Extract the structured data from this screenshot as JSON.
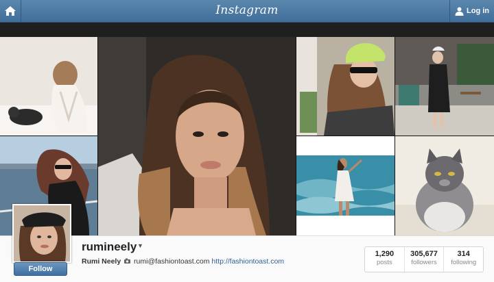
{
  "app": {
    "title": "Instagram",
    "login_label": "Log in"
  },
  "icons": {
    "home": "home-icon",
    "user": "user-icon",
    "camera": "camera-icon"
  },
  "profile": {
    "username": "rumineely",
    "full_name": "Rumi Neely",
    "email": "rumi@fashiontoast.com",
    "website": "http://fashiontoast.com",
    "follow_label": "Follow",
    "stats": [
      {
        "value": "1,290",
        "label": "posts"
      },
      {
        "value": "305,677",
        "label": "followers"
      },
      {
        "value": "314",
        "label": "following"
      }
    ]
  },
  "colors": {
    "topbar": "#4a7aa5",
    "follow_button": "#4a7bab",
    "link": "#2d5f92"
  }
}
